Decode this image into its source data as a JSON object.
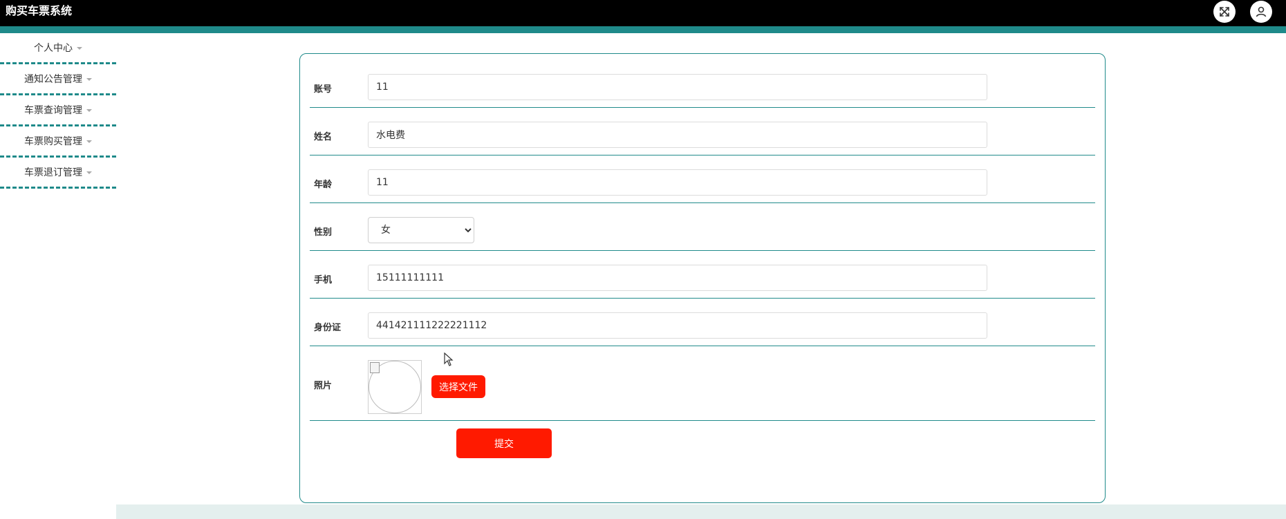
{
  "app": {
    "title": "购买车票系统"
  },
  "header": {
    "fullscreen_icon": "fullscreen-icon",
    "user_icon": "user-icon"
  },
  "sidebar": {
    "items": [
      {
        "label": "个人中心"
      },
      {
        "label": "通知公告管理"
      },
      {
        "label": "车票查询管理"
      },
      {
        "label": "车票购买管理"
      },
      {
        "label": "车票退订管理"
      }
    ]
  },
  "form": {
    "account": {
      "label": "账号",
      "value": "11"
    },
    "name": {
      "label": "姓名",
      "value": "水电费"
    },
    "age": {
      "label": "年龄",
      "value": "11"
    },
    "gender": {
      "label": "性别",
      "value": "女",
      "options": [
        "女"
      ]
    },
    "phone": {
      "label": "手机",
      "value": "15111111111"
    },
    "id_card": {
      "label": "身份证",
      "value": "441421111222221112"
    },
    "photo": {
      "label": "照片",
      "choose_file_label": "选择文件"
    },
    "submit_label": "提交"
  },
  "colors": {
    "accent": "#1f8a8a",
    "button": "#ff1a00",
    "topbar": "#000000"
  }
}
